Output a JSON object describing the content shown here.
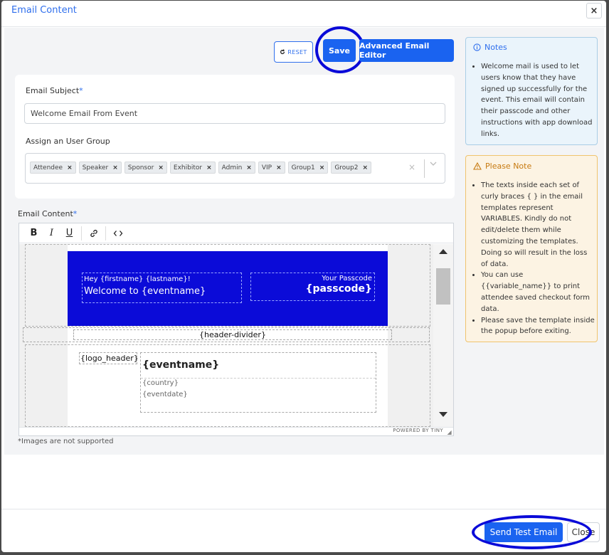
{
  "modal": {
    "title": "Email Content",
    "close_glyph": "×"
  },
  "toolbar": {
    "reset_label": "RESET",
    "save_label": "Save",
    "advanced_label": "Advanced Email Editor"
  },
  "subject": {
    "label": "Email Subject",
    "required_mark": "*",
    "value": "Welcome Email From Event"
  },
  "user_group": {
    "label": "Assign an User Group",
    "chips": [
      "Attendee",
      "Speaker",
      "Sponsor",
      "Exhibitor",
      "Admin",
      "VIP",
      "Group1",
      "Group2"
    ],
    "chip_remove_glyph": "×",
    "clear_glyph": "×"
  },
  "email_content": {
    "label": "Email Content",
    "required_mark": "*",
    "toolbar_buttons": [
      "bold-icon",
      "italic-icon",
      "underline-icon",
      "link-icon",
      "code-icon"
    ],
    "template": {
      "greeting": "Hey {firstname} {lastname}!",
      "welcome": "Welcome to {eventname}",
      "passcode_label": "Your Passcode",
      "passcode": "{passcode}",
      "header_divider": "{header-divider}",
      "logo_header": "{logo_header}",
      "eventname": "{eventname}",
      "country": "{country}",
      "eventdate": "{eventdate}"
    },
    "banner_color": "#0b0bd8",
    "status_text": "POWERED BY TINY",
    "images_note": "*Images are not supported"
  },
  "notes": {
    "title": "Notes",
    "items": [
      "Welcome mail is used to let users know that they have signed up successfully for the event. This email will contain their passcode and other instructions with app download links."
    ]
  },
  "please_note": {
    "title": "Please Note",
    "items": [
      "The texts inside each set of curly braces { } in the email templates represent VARIABLES. Kindly do not edit/delete them while customizing the templates. Doing so will result in the loss of data.",
      "You can use {{variable_name}} to print attendee saved checkout form data.",
      "Please save the template inside the popup before exiting."
    ]
  },
  "footer": {
    "send_test_label": "Send Test Email",
    "close_label": "Close"
  },
  "colors": {
    "primary": "#1a63f0",
    "highlight_circle": "#0a0ad8",
    "notes_border": "#a9cde6",
    "warning_border": "#f0c46e"
  }
}
